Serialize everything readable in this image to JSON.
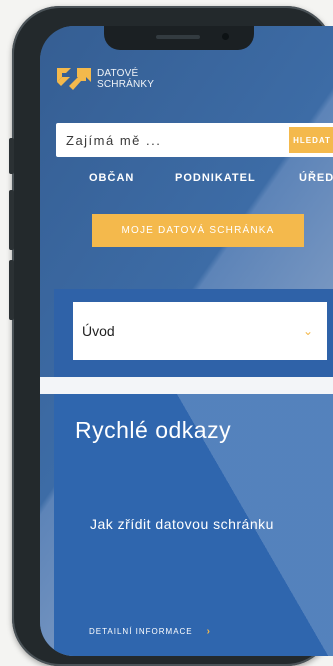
{
  "brand": {
    "line1": "DATOVÉ",
    "line2": "SCHRÁNKY",
    "accent": "#f4b94c",
    "primary": "#2f66ae"
  },
  "search": {
    "placeholder": "Zajímá mě ...",
    "button_label": "HLEDAT"
  },
  "nav": {
    "items": [
      {
        "label": "OBČAN"
      },
      {
        "label": "PODNIKATEL"
      },
      {
        "label": "ÚŘEDN"
      }
    ]
  },
  "cta": {
    "label": "MOJE DATOVÁ SCHRÁNKA"
  },
  "select": {
    "value": "Úvod"
  },
  "quick_links": {
    "title": "Rychlé odkazy",
    "item": "Jak zřídit datovou schránku",
    "detail_label": "DETAILNÍ INFORMACE",
    "detail_arrow": "›"
  },
  "icons": {
    "logo": "datove-schranky-logo-icon",
    "select_chevron": "chevron-down-icon",
    "detail_arrow": "chevron-right-icon"
  }
}
